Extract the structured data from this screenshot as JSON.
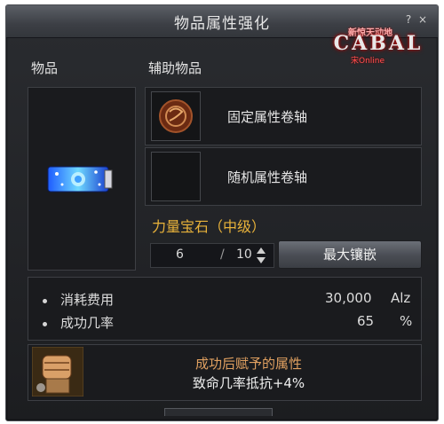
{
  "window": {
    "title": "物品属性强化",
    "help": "?",
    "close": "×"
  },
  "logo": {
    "main": "CABAL",
    "top": "新惊天动地",
    "bottom": "宋Online"
  },
  "labels": {
    "item": "物品",
    "aux_item": "辅助物品"
  },
  "aux_rows": [
    {
      "label": "固定属性卷轴",
      "icon": "scroll-icon"
    },
    {
      "label": "随机属性卷轴",
      "icon": "empty-slot"
    }
  ],
  "gem": {
    "name": "力量宝石（中级）",
    "quantity": "6",
    "separator": "/",
    "max": "10",
    "max_button": "最大镶嵌"
  },
  "stats": [
    {
      "label": "消耗费用",
      "value": "30,000",
      "unit": "Alz"
    },
    {
      "label": "成功几率",
      "value": "65",
      "unit": "%"
    }
  ],
  "result": {
    "heading": "成功后赋予的属性",
    "text": "致命几率抵抗+4%",
    "heading_color": "#e0a060",
    "icon": "fist-icon"
  }
}
